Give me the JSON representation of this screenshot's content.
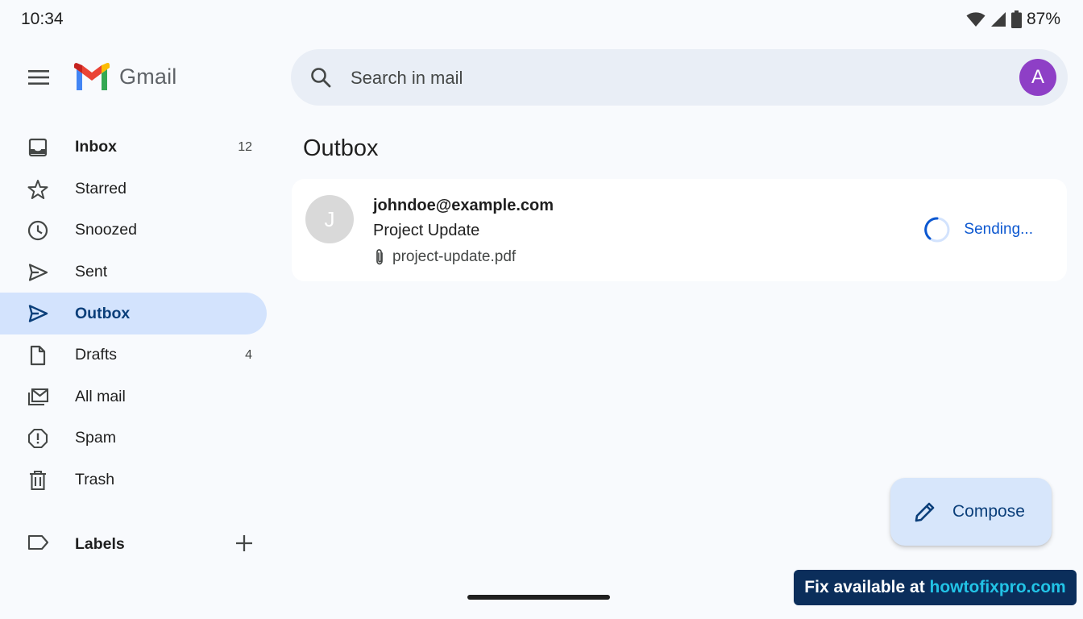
{
  "status_bar": {
    "time": "10:34",
    "battery": "87%"
  },
  "header": {
    "app_name": "Gmail",
    "search_placeholder": "Search in mail",
    "avatar_letter": "A"
  },
  "sidebar": {
    "items": [
      {
        "label": "Inbox",
        "count": "12",
        "icon": "inbox-icon"
      },
      {
        "label": "Starred",
        "count": "",
        "icon": "star-icon"
      },
      {
        "label": "Snoozed",
        "count": "",
        "icon": "clock-icon"
      },
      {
        "label": "Sent",
        "count": "",
        "icon": "send-icon"
      },
      {
        "label": "Outbox",
        "count": "",
        "icon": "outbox-icon"
      },
      {
        "label": "Drafts",
        "count": "4",
        "icon": "draft-icon"
      },
      {
        "label": "All mail",
        "count": "",
        "icon": "all-mail-icon"
      },
      {
        "label": "Spam",
        "count": "",
        "icon": "spam-icon"
      },
      {
        "label": "Trash",
        "count": "",
        "icon": "trash-icon"
      }
    ],
    "active": "Outbox",
    "labels_heading": "Labels"
  },
  "main": {
    "title": "Outbox",
    "messages": [
      {
        "avatar_letter": "J",
        "sender": "johndoe@example.com",
        "subject": "Project Update",
        "attachment": "project-update.pdf",
        "status": "Sending..."
      }
    ]
  },
  "compose": {
    "label": "Compose"
  },
  "banner": {
    "prefix": "Fix available at ",
    "link": "howtofixpro.com"
  },
  "colors": {
    "accent": "#0b57d0",
    "active_bg": "#d3e3fd",
    "avatar": "#8e3fc6"
  }
}
